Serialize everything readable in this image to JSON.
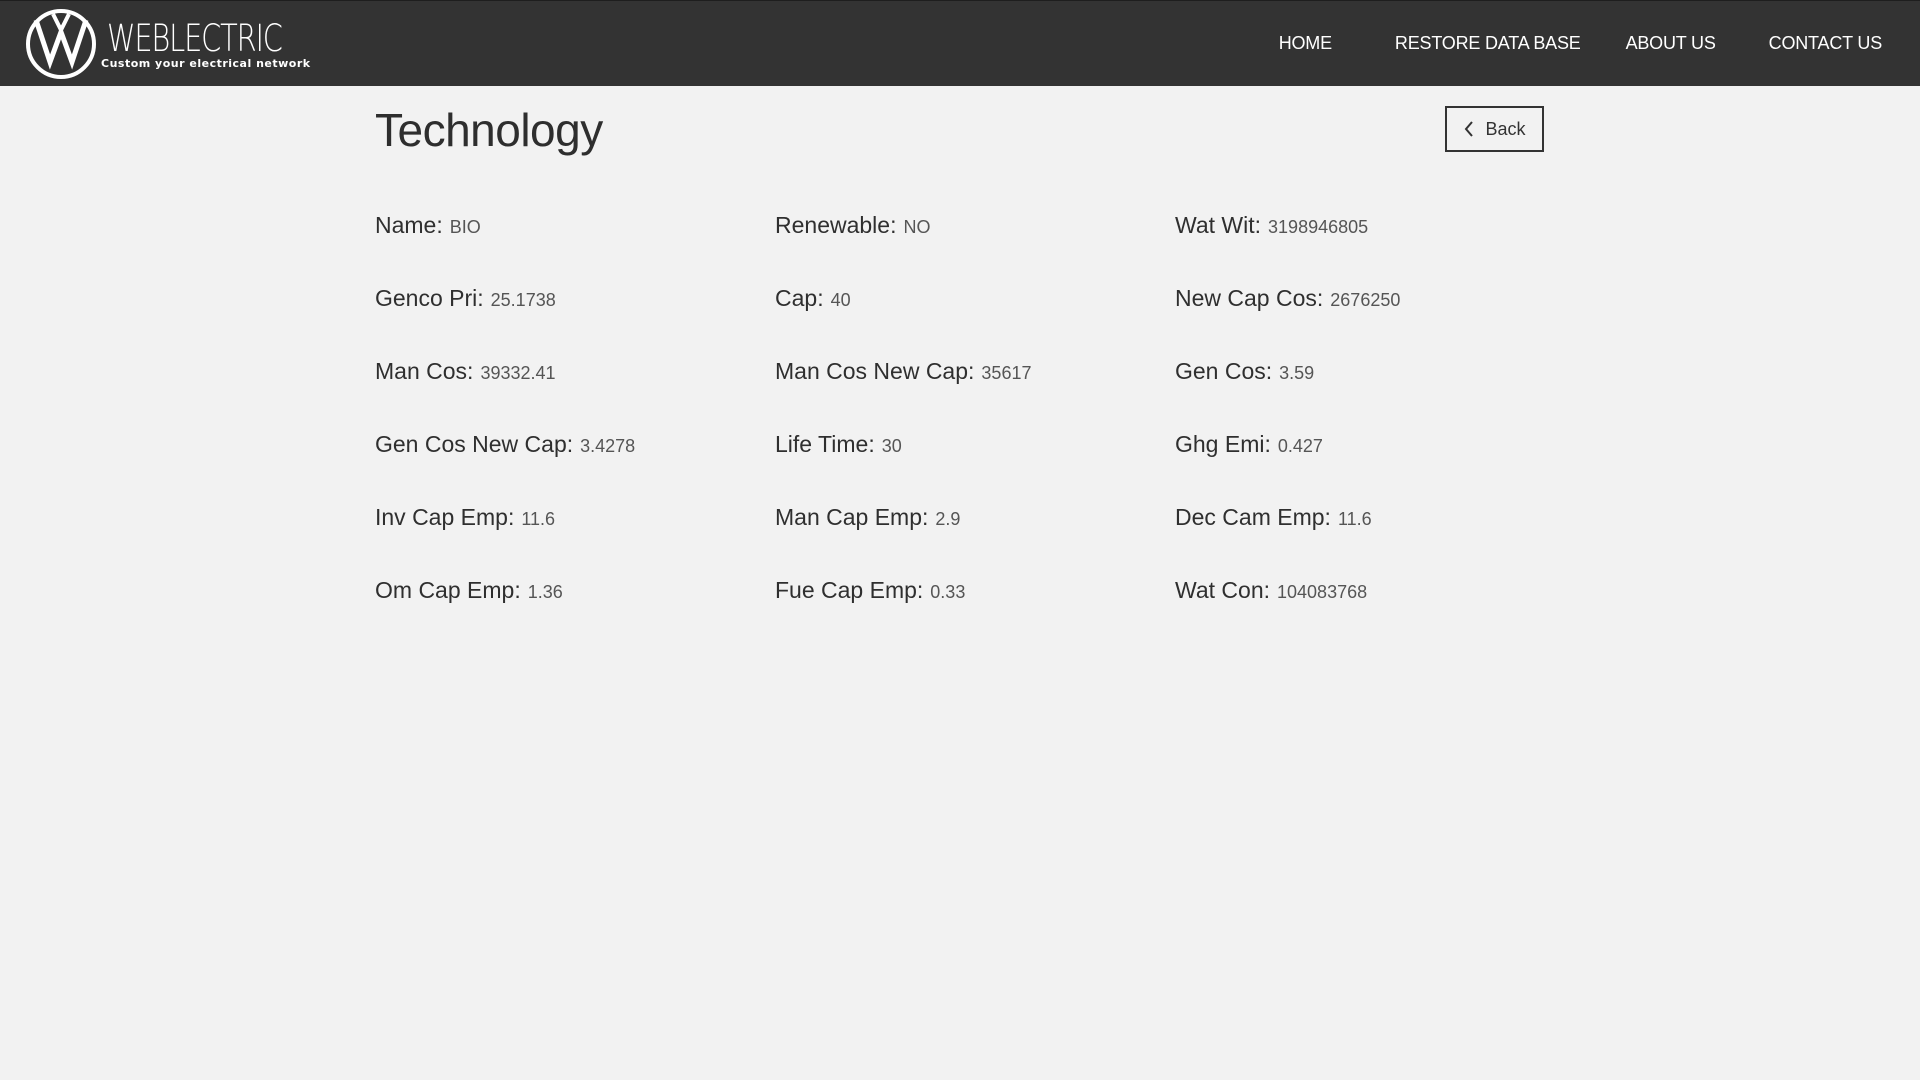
{
  "brand": {
    "name": "WEBLECTRIC",
    "tagline": "Custom your electrical network",
    "logo_icon": "w-circle-logo-icon"
  },
  "nav": {
    "items": [
      {
        "label": "HOME"
      },
      {
        "label": "RESTORE DATA BASE"
      },
      {
        "label": "ABOUT US"
      },
      {
        "label": "CONTACT US"
      }
    ]
  },
  "page": {
    "title": "Technology",
    "back_label": "Back",
    "back_icon": "chevron-left-icon"
  },
  "fields": [
    {
      "label": "Name:",
      "value": "BIO"
    },
    {
      "label": "Renewable:",
      "value": "NO"
    },
    {
      "label": "Wat Wit:",
      "value": "3198946805"
    },
    {
      "label": "Genco Pri:",
      "value": "25.1738"
    },
    {
      "label": "Cap:",
      "value": "40"
    },
    {
      "label": "New Cap Cos:",
      "value": "2676250"
    },
    {
      "label": "Man Cos:",
      "value": "39332.41"
    },
    {
      "label": "Man Cos New Cap:",
      "value": "35617"
    },
    {
      "label": "Gen Cos:",
      "value": "3.59"
    },
    {
      "label": "Gen Cos New Cap:",
      "value": "3.4278"
    },
    {
      "label": "Life Time:",
      "value": "30"
    },
    {
      "label": "Ghg Emi:",
      "value": "0.427"
    },
    {
      "label": "Inv Cap Emp:",
      "value": "11.6"
    },
    {
      "label": "Man Cap Emp:",
      "value": "2.9"
    },
    {
      "label": "Dec Cam Emp:",
      "value": "11.6"
    },
    {
      "label": "Om Cap Emp:",
      "value": "1.36"
    },
    {
      "label": "Fue Cap Emp:",
      "value": "0.33"
    },
    {
      "label": "Wat Con:",
      "value": "104083768"
    }
  ],
  "colors": {
    "navbar_bg": "#333333",
    "page_bg": "#f2f2f2",
    "text_dark": "#2f2f2f",
    "text_value": "#555555"
  }
}
